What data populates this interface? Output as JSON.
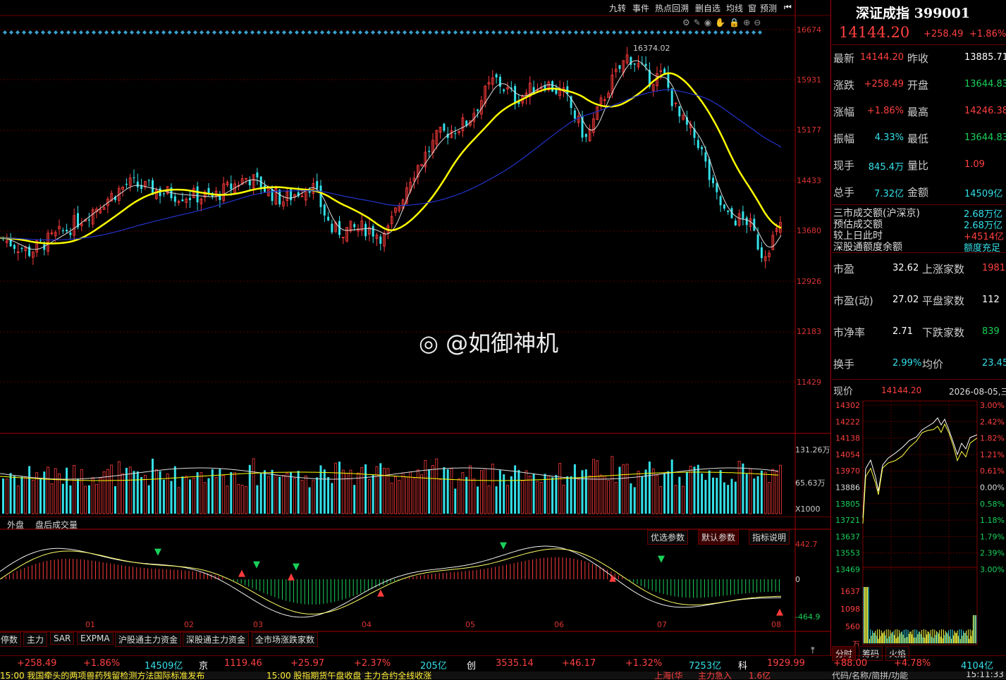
{
  "toolbar": {
    "items": [
      "九转",
      "事件",
      "热点回溯",
      "删自选",
      "均线",
      "窗",
      "预测"
    ]
  },
  "main_chart": {
    "y_ticks": [
      "16674",
      "15931",
      "15177",
      "14433",
      "13680",
      "12926",
      "12183",
      "11429"
    ],
    "peak_label": "16374.02",
    "month_labels": [
      "01",
      "02",
      "03",
      "04",
      "05",
      "06",
      "07",
      "08"
    ]
  },
  "volume": {
    "y_ticks": [
      "131.26万",
      "65.63万"
    ],
    "unit": "X1000",
    "tabs": [
      "外盘",
      "盘后成交量"
    ]
  },
  "indicator": {
    "buttons": [
      "优选参数",
      "默认参数",
      "指标说明"
    ],
    "y_ticks": [
      "442.7",
      "0",
      "-464.9"
    ],
    "tabs": [
      "停数",
      "主力",
      "SAR",
      "EXPMA",
      "沪股通主力资金",
      "深股通主力资金",
      "全市场涨跌家数"
    ]
  },
  "watermark": "@如御神机",
  "quote": {
    "name": "深证成指",
    "code": "399001",
    "price": "14144.20",
    "change": "+258.49",
    "change_pct": "+1.86%",
    "rows": [
      {
        "l1": "最新",
        "v1": "14144.20",
        "l2": "昨收",
        "v2": "13885.71"
      },
      {
        "l1": "涨跌",
        "v1": "+258.49",
        "l2": "开盘",
        "v2": "13644.83"
      },
      {
        "l1": "涨幅",
        "v1": "+1.86%",
        "l2": "最高",
        "v2": "14246.38"
      },
      {
        "l1": "振幅",
        "v1": "4.33%",
        "l2": "最低",
        "v2": "13644.83"
      },
      {
        "l1": "现手",
        "v1": "845.4万",
        "l2": "量比",
        "v2": "1.09"
      },
      {
        "l1": "总手",
        "v1": "7.32亿",
        "l2": "金额",
        "v2": "14509亿"
      }
    ],
    "market": [
      {
        "label": "三市成交额(沪深京)",
        "value": "2.68万亿"
      },
      {
        "label": "预估成交额",
        "value": "2.68万亿"
      },
      {
        "label": "较上日此时",
        "value": "+4514亿"
      },
      {
        "label": "深股通额度余额",
        "value": "额度充足"
      }
    ],
    "stats": [
      {
        "l1": "市盈",
        "v1": "32.62",
        "l2": "上涨家数",
        "v2": "1981"
      },
      {
        "l1": "市盈(动)",
        "v1": "27.02",
        "l2": "平盘家数",
        "v2": "112"
      },
      {
        "l1": "市净率",
        "v1": "2.71",
        "l2": "下跌家数",
        "v2": "839"
      },
      {
        "l1": "换手",
        "v1": "2.99%",
        "l2": "均价",
        "v2": "23.45"
      }
    ],
    "intraday_label": "现价",
    "intraday_price": "14144.20",
    "intraday_date": "2026-08-05,三",
    "intraday_left_ticks": [
      "14302",
      "14222",
      "14138",
      "14054",
      "13970",
      "13886",
      "13805",
      "13721",
      "13637",
      "13553",
      "13469"
    ],
    "intraday_right_ticks": [
      "3.00%",
      "2.42%",
      "1.82%",
      "1.21%",
      "0.61%",
      "0.00%",
      "0.58%",
      "1.18%",
      "1.79%",
      "2.39%",
      "3.00%"
    ],
    "intraday_vol_ticks": [
      "1637",
      "1098",
      "560",
      "万"
    ],
    "tabs": [
      "分时",
      "筹码",
      "火焰"
    ]
  },
  "bottom_bar": {
    "items": [
      {
        "t": "+258.49",
        "c": "red"
      },
      {
        "t": "+1.86%",
        "c": "red"
      },
      {
        "t": "14509亿",
        "c": "cyan"
      },
      {
        "t": "京",
        "c": "white"
      },
      {
        "t": "1119.46",
        "c": "red"
      },
      {
        "t": "+25.97",
        "c": "red"
      },
      {
        "t": "+2.37%",
        "c": "red"
      },
      {
        "t": "205亿",
        "c": "cyan"
      },
      {
        "t": "创",
        "c": "white"
      },
      {
        "t": "3535.14",
        "c": "red"
      },
      {
        "t": "+46.17",
        "c": "red"
      },
      {
        "t": "+1.32%",
        "c": "red"
      },
      {
        "t": "7253亿",
        "c": "cyan"
      },
      {
        "t": "科",
        "c": "white"
      },
      {
        "t": "1929.99",
        "c": "red"
      },
      {
        "t": "+88.00",
        "c": "red"
      },
      {
        "t": "+4.78%",
        "c": "red"
      },
      {
        "t": "4104亿",
        "c": "cyan"
      }
    ],
    "ticker1": "15:00 我国牵头的两项兽药残留检测方法国际标准发布",
    "ticker2": "15:00 股指期货午盘收盘 主力合约全线收涨",
    "ticker3": "上海(华",
    "ticker4": "主力急入",
    "ticker5": "1.6亿",
    "ticker6": "代码/名称/简拼/功能",
    "clock": "15:11:33"
  },
  "colors": {
    "up": "#ff3b3b",
    "down": "#34e0e8",
    "ma_yellow": "#ffff00",
    "ma_blue": "#2233cc",
    "bg": "#000000"
  }
}
